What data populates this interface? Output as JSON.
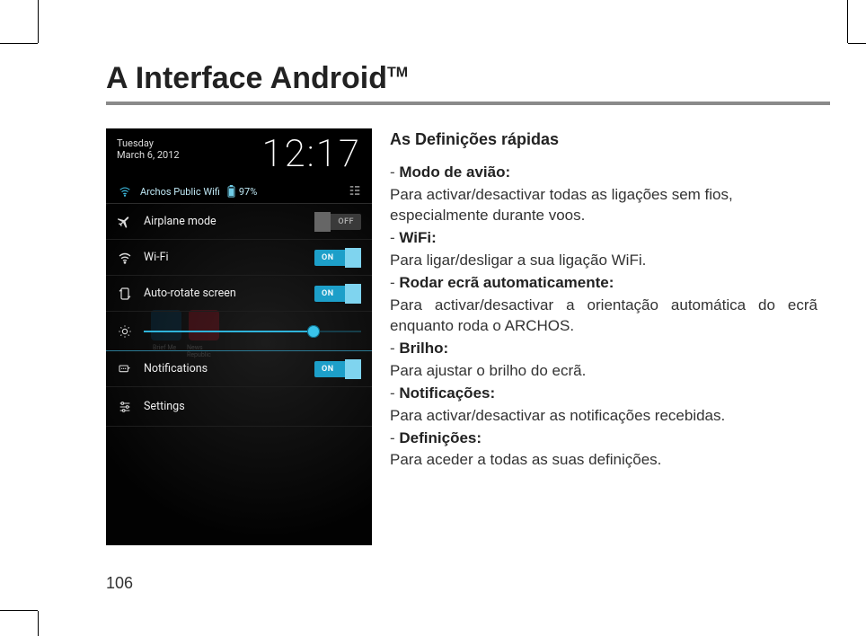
{
  "page": {
    "title_main": "A Interface Android",
    "title_tm": "TM",
    "number": "106"
  },
  "rhs": {
    "heading": "As Definições rápidas",
    "items": [
      {
        "label": "Modo de avião:",
        "desc": "Para activar/desactivar todas as ligações sem fios, especialmente durante voos."
      },
      {
        "label": "WiFi:",
        "desc": "Para ligar/desligar a sua ligação WiFi."
      },
      {
        "label": "Rodar ecrã automaticamente:",
        "desc": "Para activar/desactivar a orientação automática do ecrã enquanto roda o ARCHOS."
      },
      {
        "label": "Brilho:",
        "desc": "Para ajustar o brilho do ecrã."
      },
      {
        "label": "Notificações:",
        "desc": "Para activar/desactivar as notificações recebidas."
      },
      {
        "label": "Definições:",
        "desc": "Para aceder a todas as suas definições."
      }
    ]
  },
  "screenshot": {
    "date_line1": "Tuesday",
    "date_line2": "March 6, 2012",
    "time": "12:17",
    "wifi_name": "Archos Public Wifi",
    "battery_pct": "97%",
    "rows": {
      "airplane": {
        "label": "Airplane mode",
        "state": "OFF"
      },
      "wifi": {
        "label": "Wi-Fi",
        "state": "ON"
      },
      "autorotate": {
        "label": "Auto-rotate screen",
        "state": "ON"
      },
      "notifications": {
        "label": "Notifications",
        "state": "ON"
      },
      "settings": {
        "label": "Settings"
      }
    },
    "brightness": {
      "percent": 78
    },
    "bg": {
      "tile1": "Brief Me",
      "tile2": "News Republic"
    }
  }
}
